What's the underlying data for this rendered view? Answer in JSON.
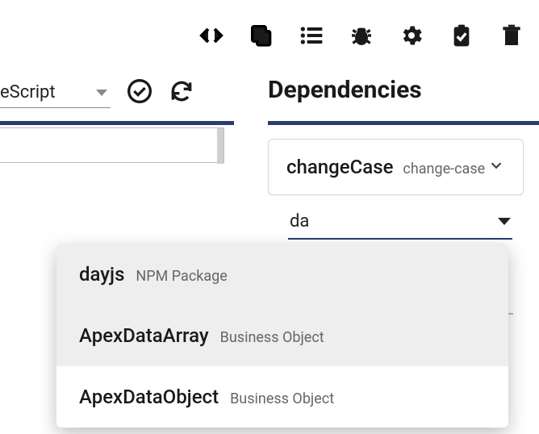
{
  "language_selector": {
    "label": "eScript"
  },
  "dependencies": {
    "title": "Dependencies",
    "item": {
      "name": "changeCase",
      "package": "change-case"
    },
    "search_value": "da"
  },
  "autocomplete": [
    {
      "name": "dayjs",
      "type": "NPM Package"
    },
    {
      "name": "ApexDataArray",
      "type": "Business Object"
    },
    {
      "name": "ApexDataObject",
      "type": "Business Object"
    }
  ]
}
